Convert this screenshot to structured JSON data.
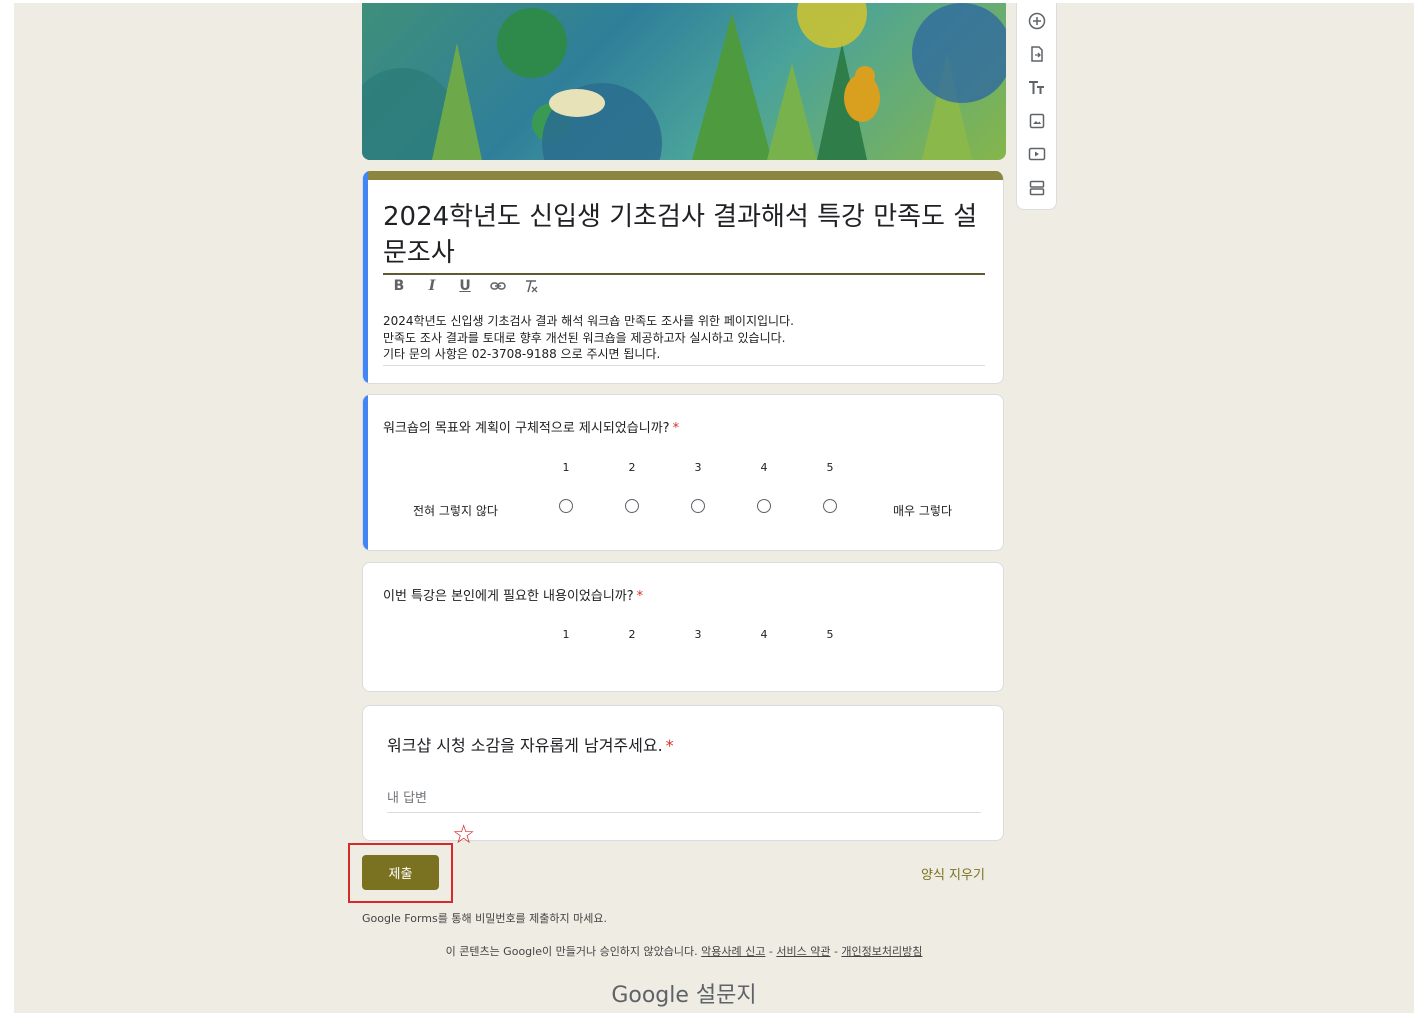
{
  "form": {
    "title": "2024학년도 신입생 기초검사 결과해석 특강 만족도 설문조사",
    "formatting": {
      "bold": "B",
      "italic": "I",
      "underline": "U",
      "link": "⊖",
      "clear": "✕"
    },
    "description_lines": [
      "2024학년도 신입생 기초검사 결과 해석 워크숍 만족도 조사를 위한 페이지입니다.",
      "만족도 조사 결과를 토대로 향후 개선된 워크숍을 제공하고자 실시하고 있습니다.",
      "기타 문의 사항은 02-3708-9188 으로 주시면 됩니다."
    ]
  },
  "questions": [
    {
      "title": "워크숍의 목표와 계획이 구체적으로 제시되었습니까?",
      "required_mark": "*",
      "scale": [
        "1",
        "2",
        "3",
        "4",
        "5"
      ],
      "low_label": "전혀 그렇지 않다",
      "high_label": "매우 그렇다"
    },
    {
      "title": "이번 특강은 본인에게 필요한 내용이었습니까?",
      "required_mark": "*",
      "scale": [
        "1",
        "2",
        "3",
        "4",
        "5"
      ]
    },
    {
      "title": "워크샵 시청 소감을 자유롭게 남겨주세요.",
      "required_mark": "*",
      "answer_placeholder": "내 답변"
    }
  ],
  "actions": {
    "submit_label": "제출",
    "clear_label": "양식 지우기"
  },
  "notes": {
    "password_warning": "Google Forms를 통해 비밀번호를 제출하지 마세요.",
    "footer_prefix": "이 콘텐츠는 Google이 만들거나 승인하지 않았습니다.",
    "footer_links": [
      "악용사례 신고",
      "서비스 약관",
      "개인정보처리방침"
    ],
    "brand_google": "Google",
    "brand_product": "설문지"
  },
  "toolbar_icons": [
    "add-question-icon",
    "import-questions-icon",
    "add-title-icon",
    "add-image-icon",
    "add-video-icon",
    "add-section-icon"
  ],
  "colors": {
    "theme": "#7a7220",
    "accent_bar": "#4285f4",
    "background": "#eeece3",
    "required": "#d93025",
    "highlight": "#d62b2b"
  }
}
